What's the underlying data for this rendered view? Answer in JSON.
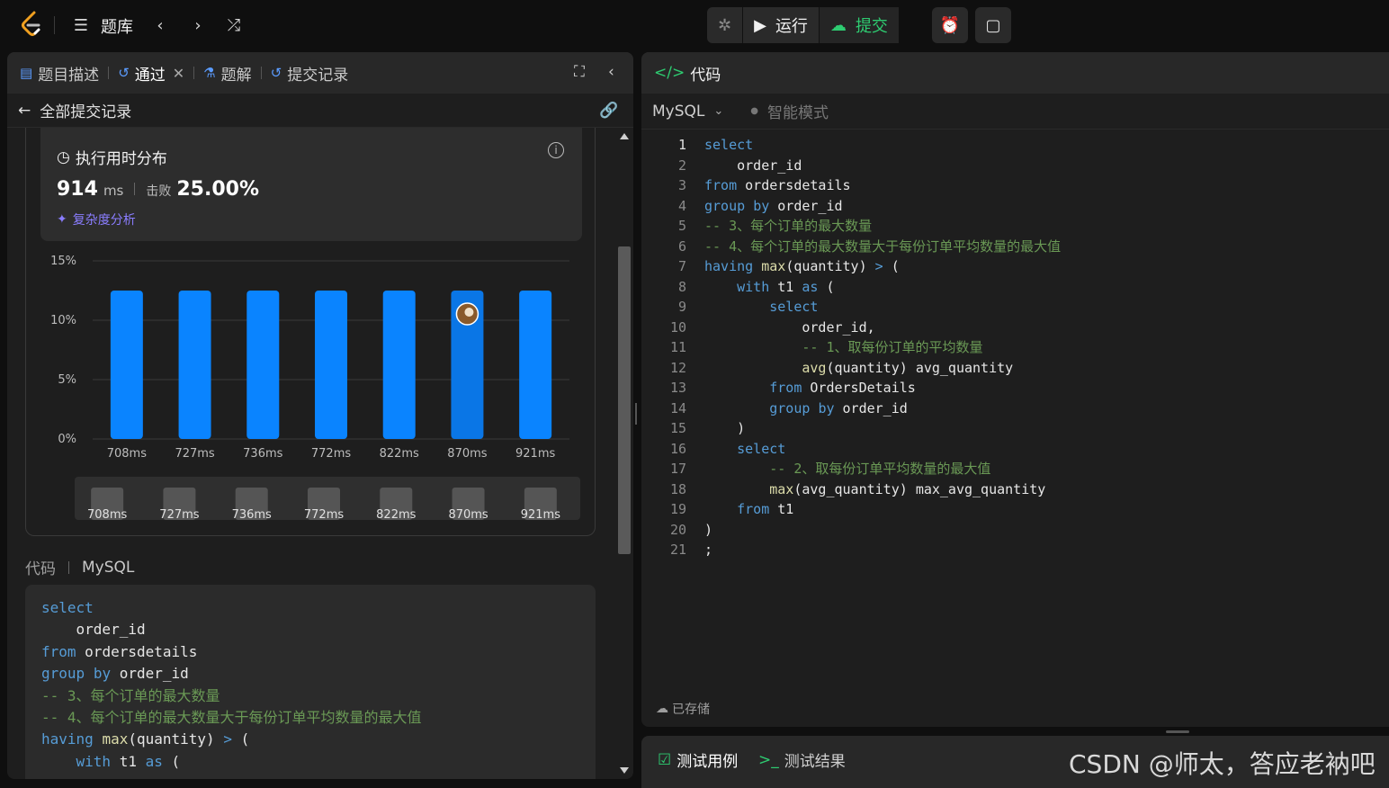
{
  "topbar": {
    "problems_label": "题库",
    "run_label": "运行",
    "submit_label": "提交"
  },
  "left": {
    "tabs": [
      {
        "label": "题目描述"
      },
      {
        "label": "通过"
      },
      {
        "label": "题解"
      },
      {
        "label": "提交记录"
      }
    ],
    "back_label": "全部提交记录",
    "distribution": {
      "title": "执行用时分布",
      "runtime": "914",
      "runtime_unit": "ms",
      "beats_label": "击败",
      "beats_value": "25.00%",
      "complexity_label": "复杂度分析"
    },
    "code_section": {
      "label": "代码",
      "language": "MySQL"
    },
    "code_lines": [
      "select",
      "    order_id",
      "from ordersdetails",
      "group by order_id",
      "-- 3、每个订单的最大数量",
      "-- 4、每个订单的最大数量大于每份订单平均数量的最大值",
      "having max(quantity) > (",
      "    with t1 as ("
    ]
  },
  "chart_data": {
    "type": "bar",
    "categories": [
      "708ms",
      "727ms",
      "736ms",
      "772ms",
      "822ms",
      "870ms",
      "921ms"
    ],
    "values": [
      12.5,
      12.5,
      12.5,
      12.5,
      12.5,
      12.5,
      12.5
    ],
    "y_ticks": [
      "0%",
      "5%",
      "10%",
      "15%"
    ],
    "ylim": [
      0,
      15
    ],
    "highlight_index": 5,
    "colors": {
      "bar": "#0a84ff",
      "bar_highlight": "#0a76e6",
      "grid": "#3a3a3a"
    }
  },
  "right": {
    "header_title": "代码",
    "language": "MySQL",
    "mode_label": "智能模式",
    "saved_label": "已存储",
    "code_lines": [
      "select",
      "    order_id",
      "from ordersdetails",
      "group by order_id",
      "-- 3、每个订单的最大数量",
      "-- 4、每个订单的最大数量大于每份订单平均数量的最大值",
      "having max(quantity) > (",
      "    with t1 as (",
      "        select",
      "            order_id,",
      "            -- 1、取每份订单的平均数量",
      "            avg(quantity) avg_quantity",
      "        from OrdersDetails",
      "        group by order_id",
      "    )",
      "    select",
      "        -- 2、取每份订单平均数量的最大值",
      "        max(avg_quantity) max_avg_quantity",
      "    from t1",
      ")",
      ";"
    ]
  },
  "bottom": {
    "testcase_label": "测试用例",
    "result_label": "测试结果"
  },
  "watermark": "CSDN @师太，答应老衲吧"
}
